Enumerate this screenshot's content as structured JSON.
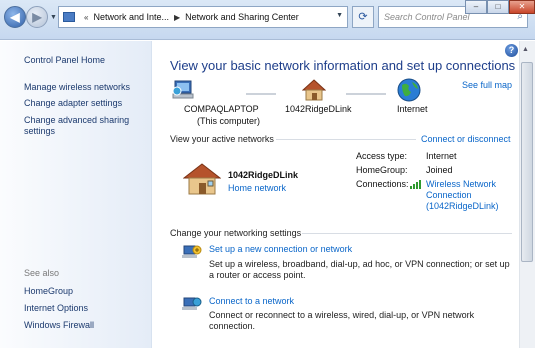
{
  "titlebar": {
    "breadcrumb": [
      "Network and Inte...",
      "Network and Sharing Center"
    ],
    "search_placeholder": "Search Control Panel"
  },
  "sidebar": {
    "home": "Control Panel Home",
    "links": [
      "Manage wireless networks",
      "Change adapter settings",
      "Change advanced sharing settings"
    ],
    "see_also_heading": "See also",
    "see_also": [
      "HomeGroup",
      "Internet Options",
      "Windows Firewall"
    ]
  },
  "main": {
    "title": "View your basic network information and set up connections",
    "see_full_map": "See full map",
    "map": {
      "computer": "COMPAQLAPTOP",
      "computer_sub": "(This computer)",
      "network": "1042RidgeDLink",
      "internet": "Internet"
    },
    "active": {
      "heading": "View your active networks",
      "connect_link": "Connect or disconnect",
      "name": "1042RidgeDLink",
      "type": "Home network",
      "access_label": "Access type:",
      "access_value": "Internet",
      "homegroup_label": "HomeGroup:",
      "homegroup_value": "Joined",
      "connections_label": "Connections:",
      "connections_value": "Wireless Network Connection (1042RidgeDLink)"
    },
    "change": {
      "heading": "Change your networking settings",
      "tasks": [
        {
          "link": "Set up a new connection or network",
          "desc": "Set up a wireless, broadband, dial-up, ad hoc, or VPN connection; or set up a router or access point."
        },
        {
          "link": "Connect to a network",
          "desc": "Connect or reconnect to a wireless, wired, dial-up, or VPN network connection."
        }
      ]
    }
  }
}
